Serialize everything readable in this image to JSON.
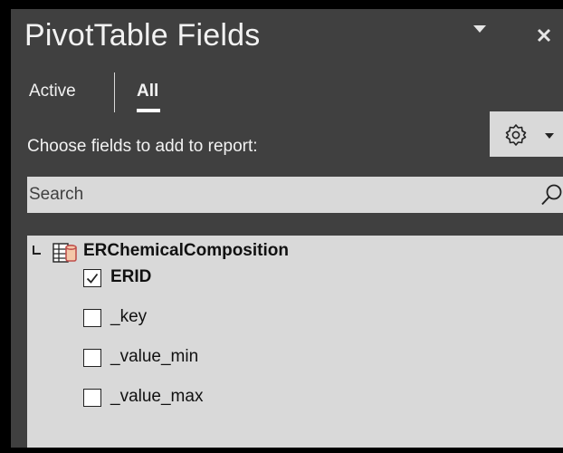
{
  "pane": {
    "title": "PivotTable Fields"
  },
  "tabs": [
    {
      "label": "Active",
      "selected": false
    },
    {
      "label": "All",
      "selected": true
    }
  ],
  "instructions": "Choose fields to add to report:",
  "tools_icon": "gear-icon",
  "search": {
    "placeholder": "Search",
    "value": ""
  },
  "field_list": {
    "table_name": "ERChemicalComposition",
    "fields": [
      {
        "label": "ERID",
        "checked": true
      },
      {
        "label": "_key",
        "checked": false
      },
      {
        "label": "_value_min",
        "checked": false
      },
      {
        "label": "_value_max",
        "checked": false
      }
    ]
  },
  "colors": {
    "pane_background": "#404040",
    "control_background": "#d9d9d9",
    "table_icon_accent": "#c0504d"
  }
}
